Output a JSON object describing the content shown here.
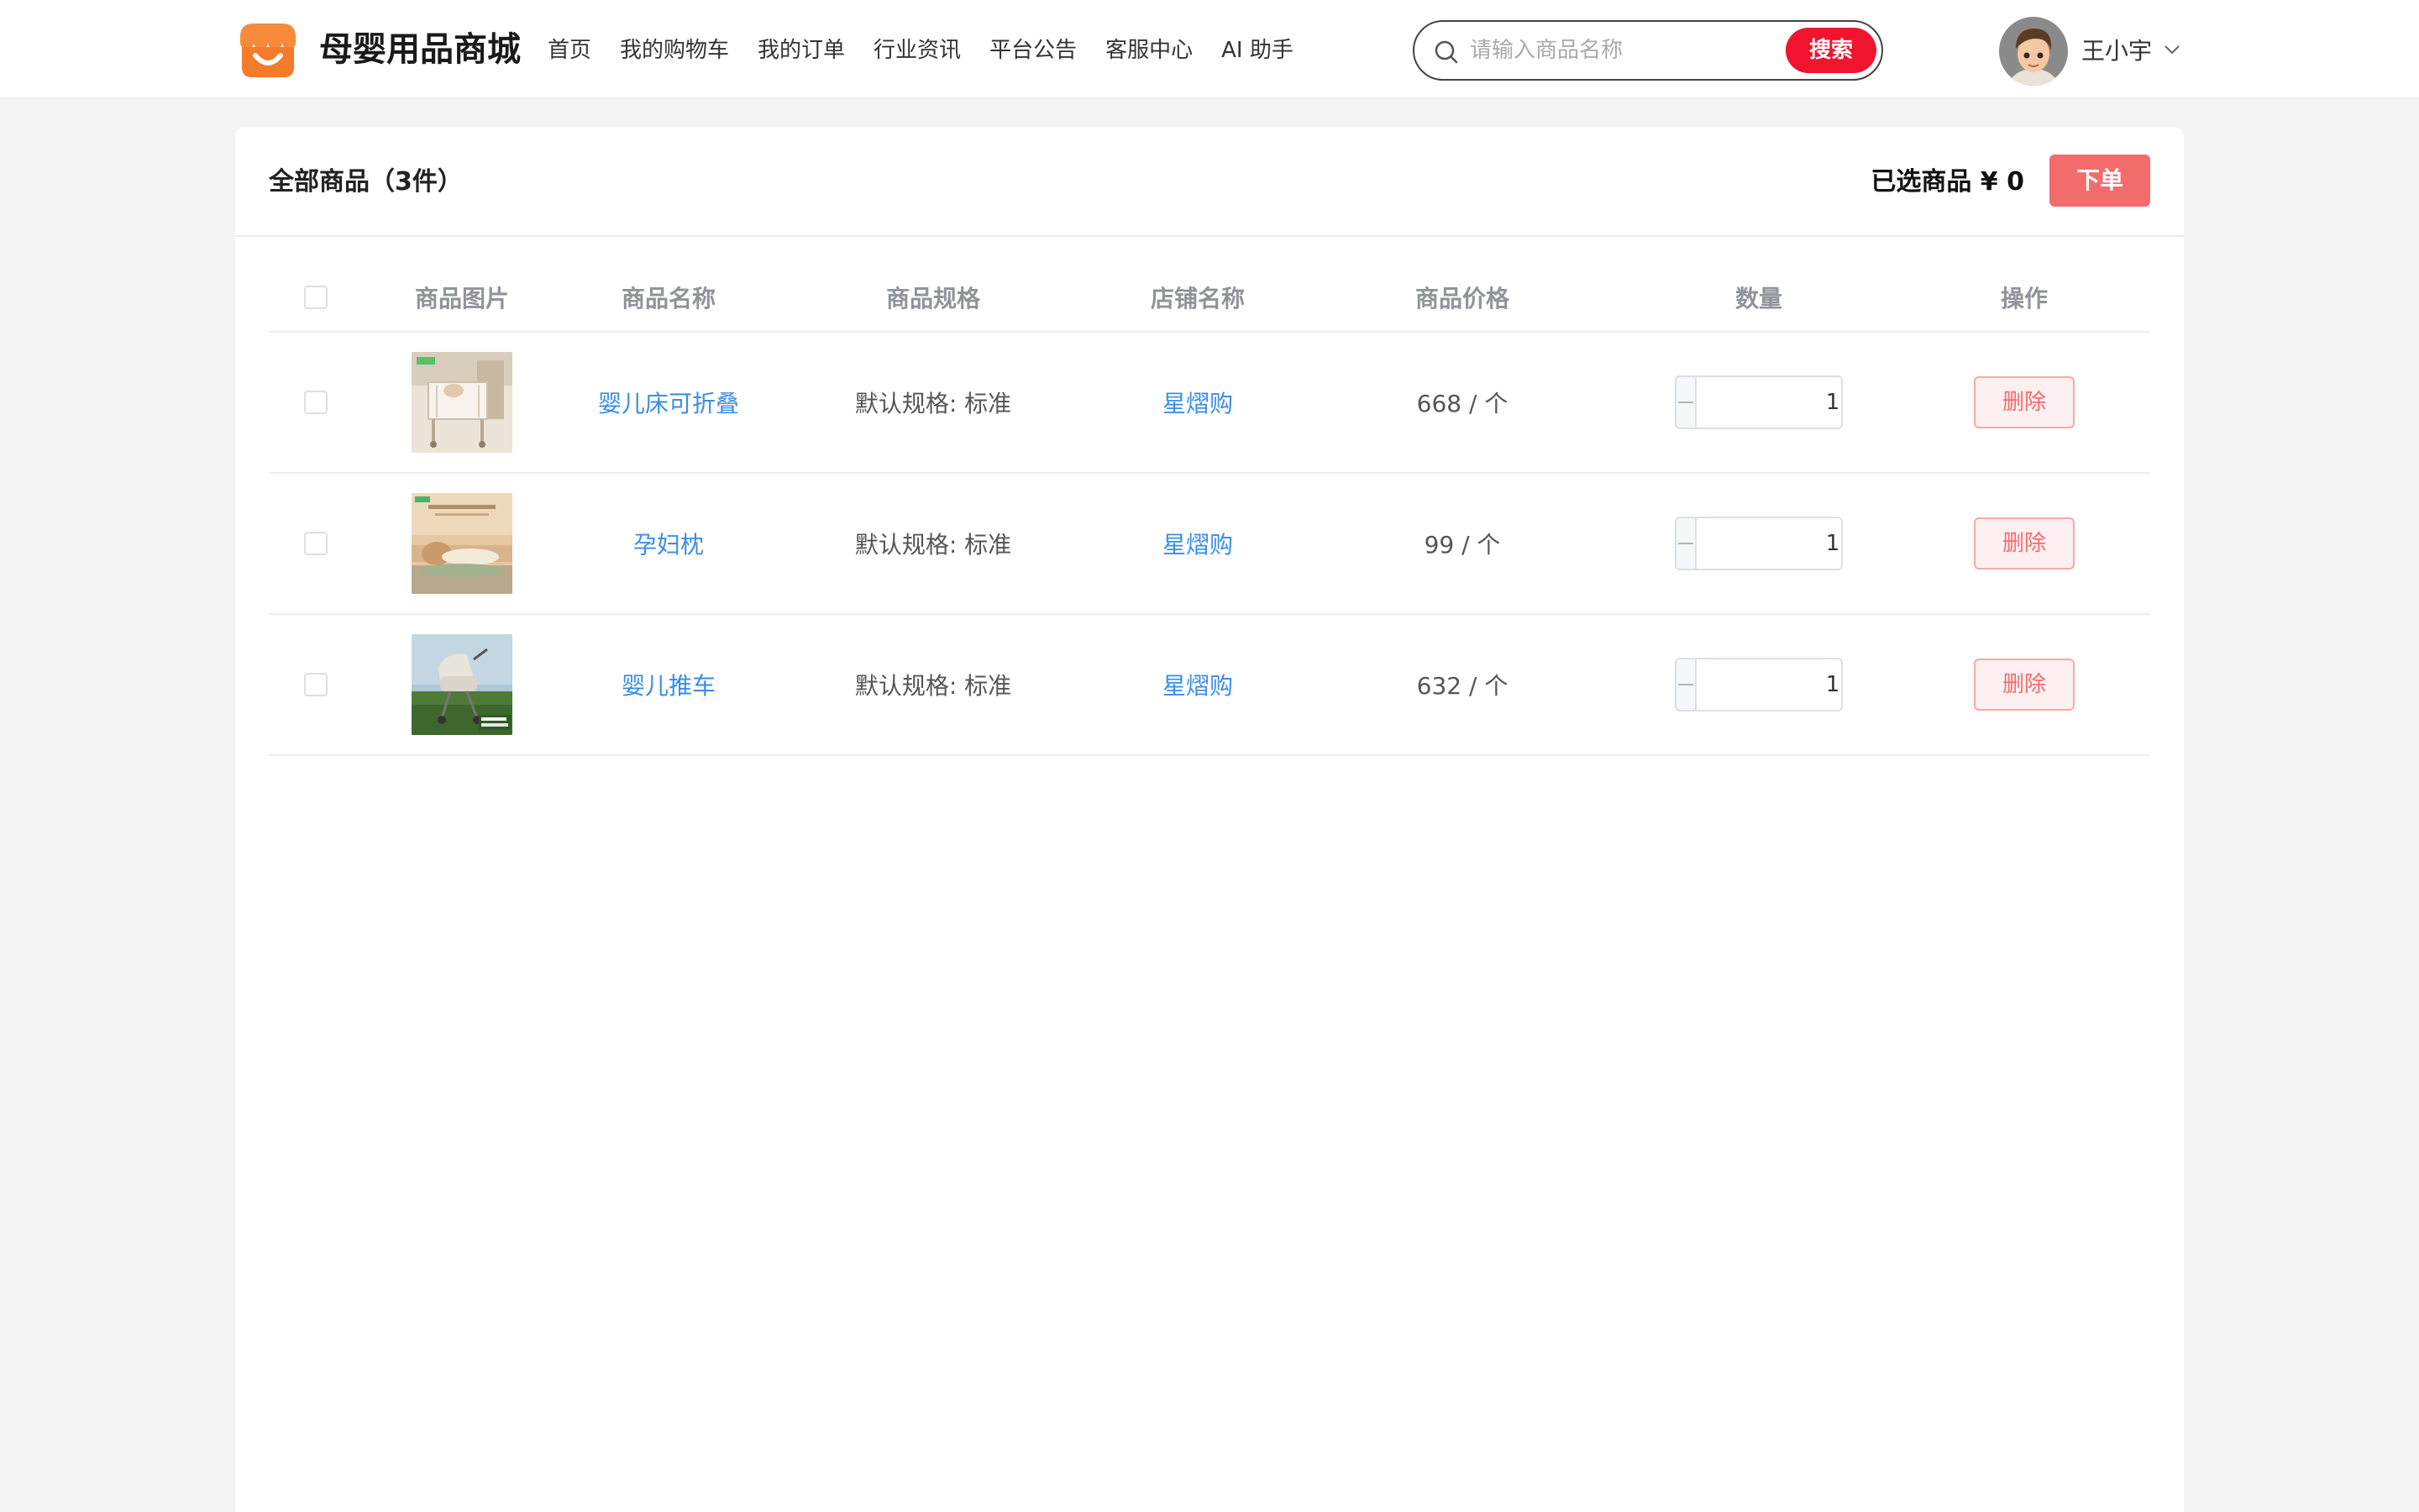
{
  "header": {
    "brand": "母婴用品商城",
    "nav": [
      "首页",
      "我的购物车",
      "我的订单",
      "行业资讯",
      "平台公告",
      "客服中心",
      "AI 助手"
    ],
    "search_placeholder": "请输入商品名称",
    "search_button": "搜索",
    "user_name": "王小宇"
  },
  "cart": {
    "title": "全部商品（3件）",
    "selected_label": "已选商品 ¥ 0",
    "order_button": "下单",
    "columns": [
      "商品图片",
      "商品名称",
      "商品规格",
      "店铺名称",
      "商品价格",
      "数量",
      "操作"
    ],
    "items": [
      {
        "name": "婴儿床可折叠",
        "spec": "默认规格: 标准",
        "shop": "星熠购",
        "price": "668 / 个",
        "qty": "1",
        "delete": "删除"
      },
      {
        "name": "孕妇枕",
        "spec": "默认规格: 标准",
        "shop": "星熠购",
        "price": "99 / 个",
        "qty": "1",
        "delete": "删除"
      },
      {
        "name": "婴儿推车",
        "spec": "默认规格: 标准",
        "shop": "星熠购",
        "price": "632 / 个",
        "qty": "1",
        "delete": "删除"
      }
    ]
  },
  "colors": {
    "accent_red": "#f0142f",
    "order_button": "#f36c6c",
    "link_blue": "#3a8ee6",
    "logo_orange": "#f47b2a"
  }
}
